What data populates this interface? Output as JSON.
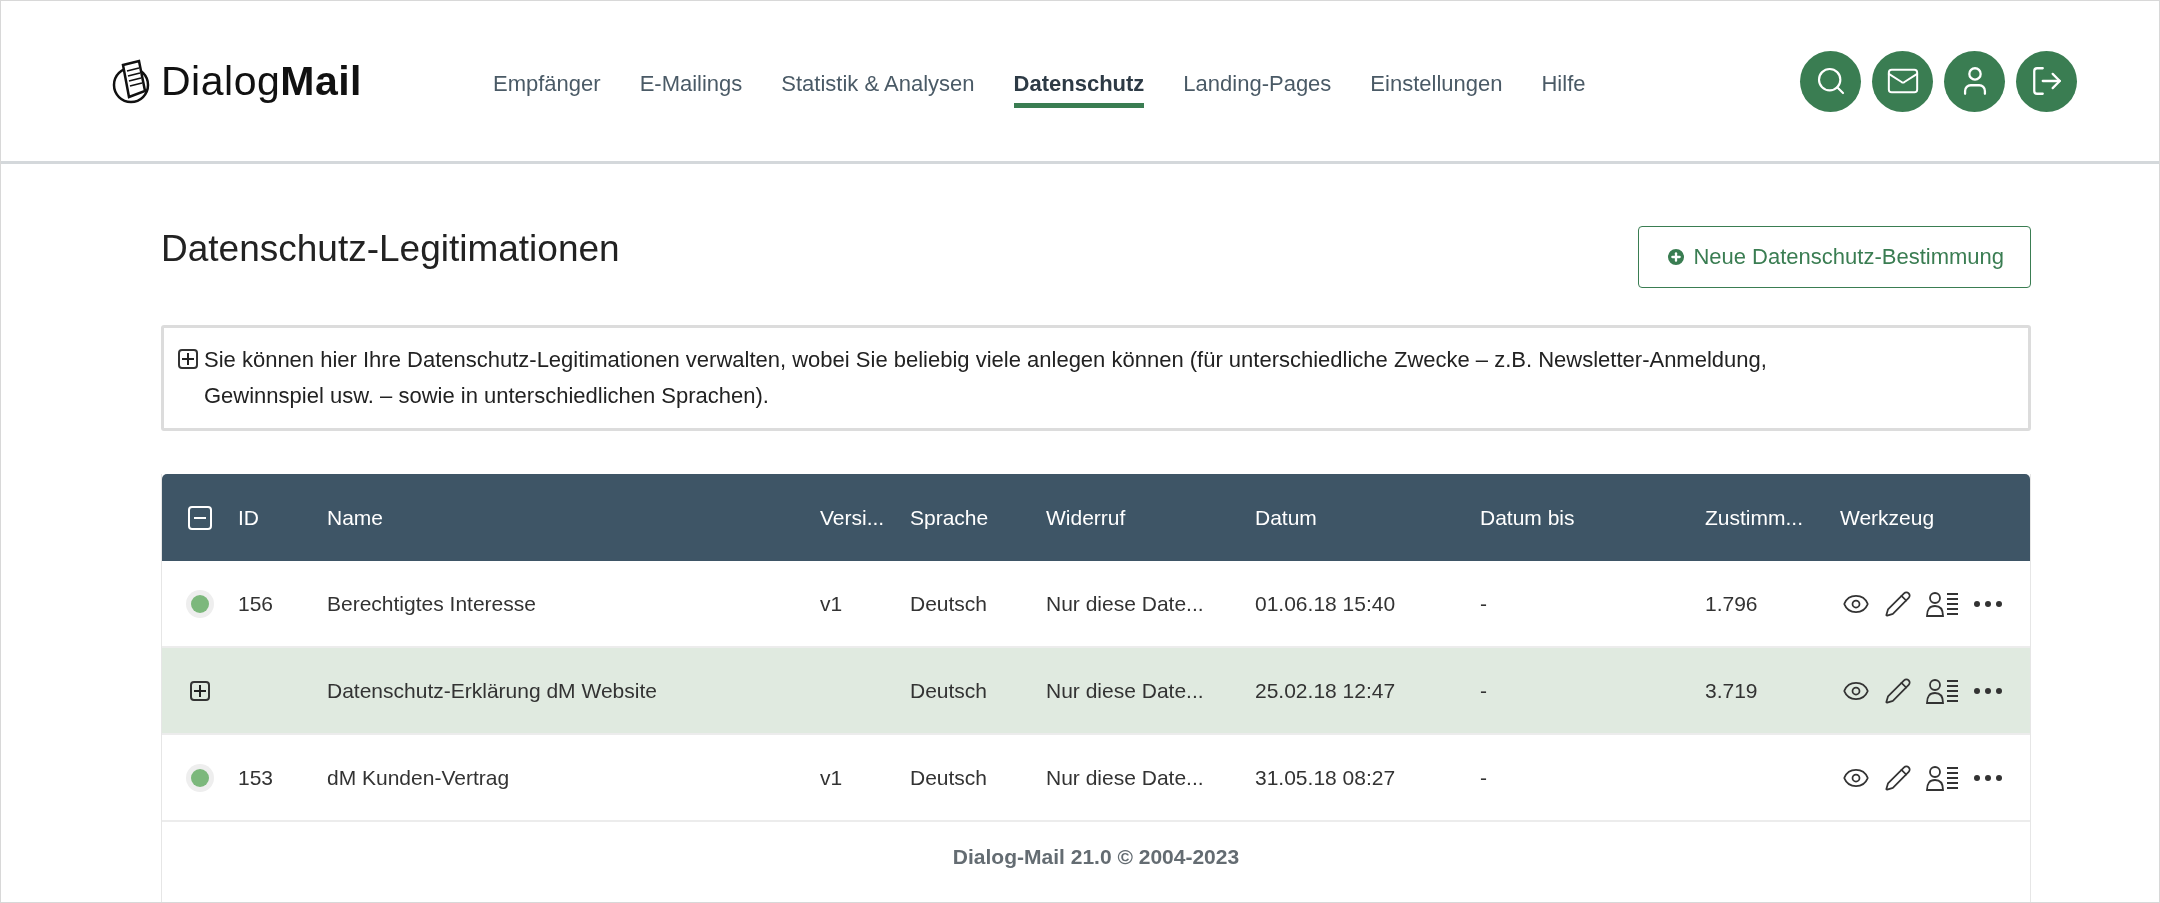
{
  "logo": {
    "text": "Dialog**Mail**"
  },
  "nav": [
    {
      "label": "Empfänger",
      "selected": false
    },
    {
      "label": "E-Mailings",
      "selected": false
    },
    {
      "label": "Statistik & Analysen",
      "selected": false
    },
    {
      "label": "Datenschutz",
      "selected": true
    },
    {
      "label": "Landing-Pages",
      "selected": false
    },
    {
      "label": "Einstellungen",
      "selected": false
    },
    {
      "label": "Hilfe",
      "selected": false
    }
  ],
  "page": {
    "title": "Datenschutz-Legitimationen",
    "new_button": "Neue Datenschutz-Bestimmung"
  },
  "info": {
    "text": "Sie können hier Ihre Datenschutz-Legitimationen verwalten, wobei Sie beliebig viele anlegen können (für unterschiedliche Zwecke – z.B. Newsletter-Anmeldung, Gewinnspiel usw. – sowie in unterschiedlichen Sprachen).",
    "expanded": false
  },
  "table": {
    "columns": [
      "ID",
      "Name",
      "Versi...",
      "Sprache",
      "Widerruf",
      "Datum",
      "Datum bis",
      "Zustimm...",
      "Werkzeug"
    ],
    "all_expanded": true,
    "rows": [
      {
        "kind": "status",
        "color": "#7cb87c",
        "selected": false,
        "cells": [
          "156",
          "Berechtigtes Interesse",
          "v1",
          "Deutsch",
          "Nur diese Date...",
          "01.06.18 15:40",
          "-",
          "1.796"
        ]
      },
      {
        "kind": "group",
        "expanded": false,
        "selected": true,
        "cells": [
          "",
          "Datenschutz-Erklärung dM Website",
          "",
          "Deutsch",
          "Nur diese Date...",
          "25.02.18 12:47",
          "-",
          "3.719"
        ]
      },
      {
        "kind": "status",
        "color": "#7cb87c",
        "selected": false,
        "cells": [
          "153",
          "dM Kunden-Vertrag",
          "v1",
          "Deutsch",
          "Nur diese Date...",
          "31.05.18 08:27",
          "-",
          ""
        ]
      }
    ]
  },
  "footer": "Dialog-Mail 21.0 © 2004-2023"
}
